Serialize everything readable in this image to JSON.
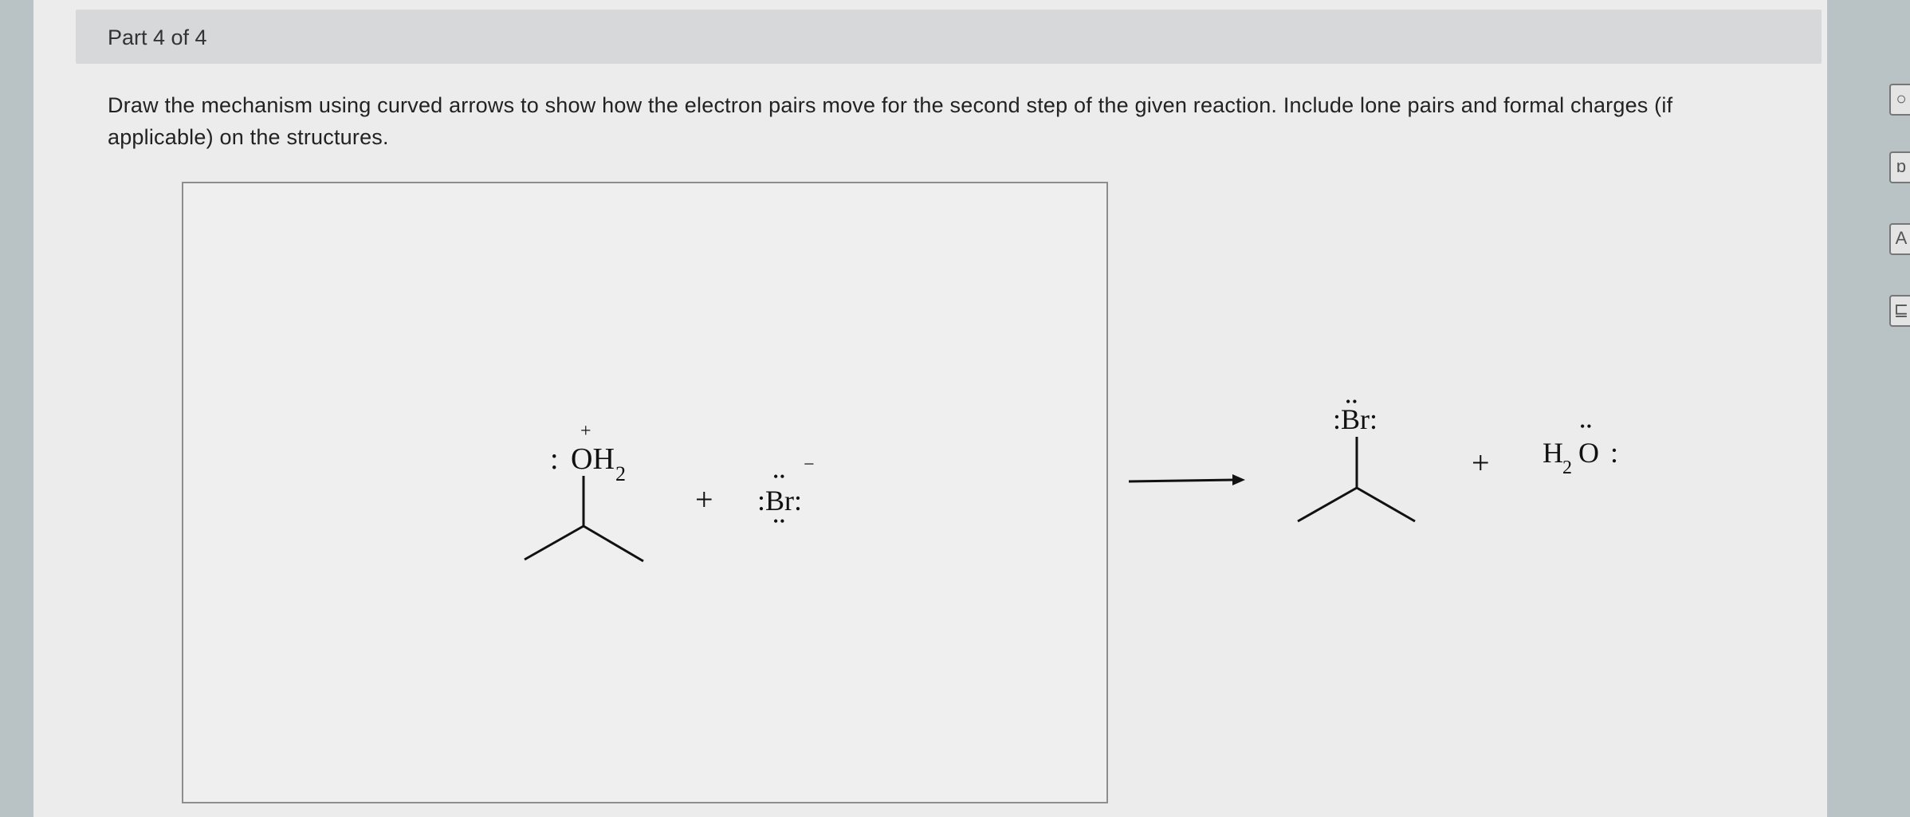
{
  "part": {
    "title": "Part 4 of 4"
  },
  "question": {
    "text": "Draw the mechanism using curved arrows to show how the electron pairs move for the second step of the given reaction. Include lone pairs and formal charges (if applicable) on the structures."
  },
  "reactants": {
    "oxonium": {
      "charge": "+",
      "lone_pair": ":",
      "label": "OH",
      "subscript": "2"
    },
    "plus": "+",
    "bromide": {
      "label": ":Br:",
      "top_dots": "••",
      "bottom_dots": "••",
      "charge": "−"
    }
  },
  "products": {
    "alkyl_bromide": {
      "label": ":Br:",
      "top_dots": "••"
    },
    "plus": "+",
    "water": {
      "label_h": "H",
      "subscript": "2",
      "label_o": "O",
      "lone_pair": ":",
      "top_dots": "••"
    }
  },
  "tools": [
    {
      "icon": "circle-icon",
      "glyph": "○"
    },
    {
      "icon": "arrow-tool-icon",
      "glyph": "ɒ"
    },
    {
      "icon": "text-tool-icon",
      "glyph": "A"
    },
    {
      "icon": "template-tool-icon",
      "glyph": "⊑"
    }
  ]
}
